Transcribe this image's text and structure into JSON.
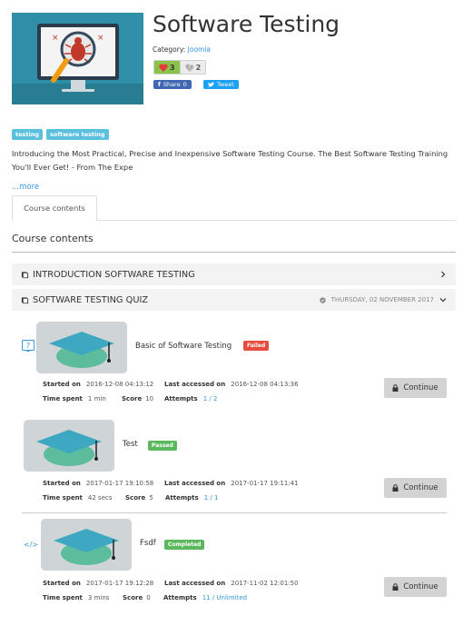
{
  "course": {
    "title": "Software Testing",
    "category_label": "Category:",
    "category": "Joomla",
    "likes": "3",
    "dislikes": "2",
    "share_label": "Share",
    "share_count": "0",
    "tweet_label": "Tweet",
    "tags": [
      "testing",
      "software testing"
    ],
    "intro": "Introducing the Most Practical, Precise and Inexpensive Software Testing Course.  The Best Software Testing Training You'll Ever Get! - From The Expe",
    "more": "...more"
  },
  "tabs": {
    "active": "Course contents"
  },
  "contents": {
    "title": "Course contents",
    "sections": [
      {
        "title": "INTRODUCTION SOFTWARE TESTING",
        "date": ""
      },
      {
        "title": "SOFTWARE TESTING QUIZ",
        "date": "THURSDAY, 02 NOVEMBER 2017"
      }
    ]
  },
  "labels": {
    "started": "Started on",
    "last": "Last accessed on",
    "time": "Time spent",
    "score": "Score",
    "attempts": "Attempts",
    "continue": "Continue"
  },
  "items": [
    {
      "icon": "?",
      "name": "Basic of Software Testing",
      "status": "Failed",
      "started": "2016-12-08 04:13:12",
      "last": "2016-12-08 04:13:36",
      "time": "1 min",
      "score": "10",
      "attempts": "1 / 2"
    },
    {
      "icon": "",
      "name": "Test",
      "status": "Passed",
      "started": "2017-01-17 19:10:58",
      "last": "2017-01-17 19:11:41",
      "time": "42 secs",
      "score": "5",
      "attempts": "1 / 1"
    },
    {
      "icon": "</>",
      "name": "Fsdf",
      "status": "Completed",
      "started": "2017-01-17 19:12:28",
      "last": "2017-11-02 12:01:50",
      "time": "3 mins",
      "score": "0",
      "attempts": "11 / Unlimited"
    }
  ],
  "colors": {
    "accent": "#3498db",
    "tag": "#5bc0de",
    "failed": "#e74c3c",
    "passed": "#5cb85c"
  }
}
